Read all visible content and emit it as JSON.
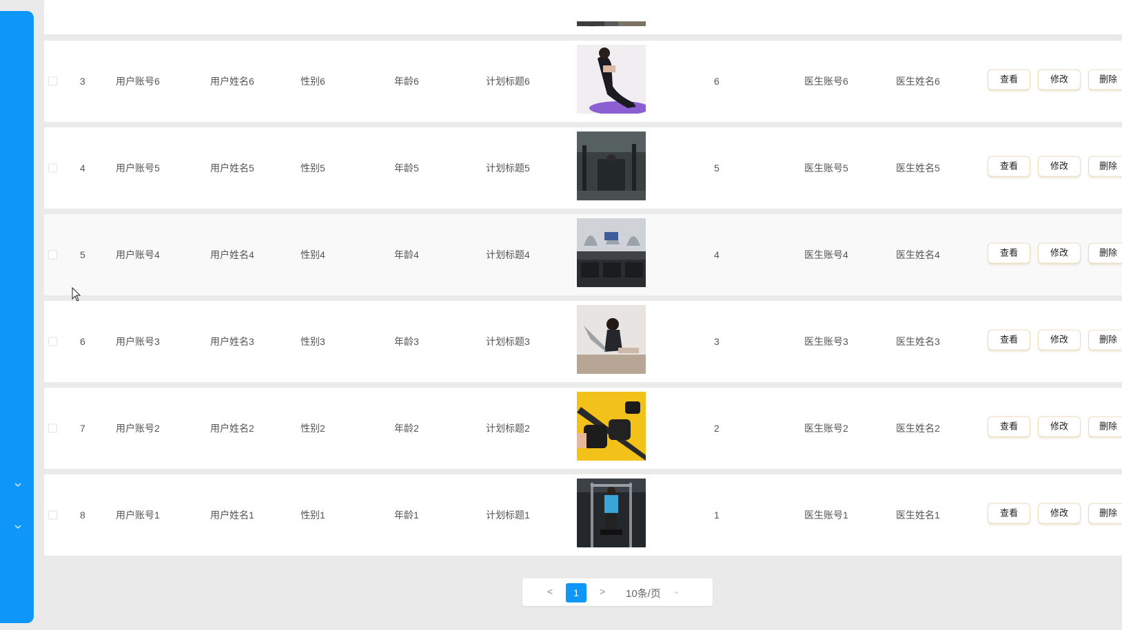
{
  "sidebar": {
    "icons": [
      "chevron-down-icon",
      "chevron-down-icon"
    ],
    "color": "#0e96f8"
  },
  "table": {
    "rows": [
      {
        "index": "3",
        "user_account": "用户账号6",
        "user_name": "用户姓名6",
        "gender": "性别6",
        "age": "年龄6",
        "plan_title": "计划标题6",
        "value": "6",
        "doctor_account": "医生账号6",
        "doctor_name": "医生姓名6",
        "image": "yoga-mat-photo"
      },
      {
        "index": "4",
        "user_account": "用户账号5",
        "user_name": "用户姓名5",
        "gender": "性别5",
        "age": "年龄5",
        "plan_title": "计划标题5",
        "value": "5",
        "doctor_account": "医生账号5",
        "doctor_name": "医生姓名5",
        "image": "gym-interior-photo"
      },
      {
        "index": "5",
        "user_account": "用户账号4",
        "user_name": "用户姓名4",
        "gender": "性别4",
        "age": "年龄4",
        "plan_title": "计划标题4",
        "value": "4",
        "doctor_account": "医生账号4",
        "doctor_name": "医生姓名4",
        "image": "treadmill-room-photo"
      },
      {
        "index": "6",
        "user_account": "用户账号3",
        "user_name": "用户姓名3",
        "gender": "性别3",
        "age": "年龄3",
        "plan_title": "计划标题3",
        "value": "3",
        "doctor_account": "医生账号3",
        "doctor_name": "医生姓名3",
        "image": "floor-stretch-photo"
      },
      {
        "index": "7",
        "user_account": "用户账号2",
        "user_name": "用户姓名2",
        "gender": "性别2",
        "age": "年龄2",
        "plan_title": "计划标题2",
        "value": "2",
        "doctor_account": "医生账号2",
        "doctor_name": "医生姓名2",
        "image": "wrist-weights-photo"
      },
      {
        "index": "8",
        "user_account": "用户账号1",
        "user_name": "用户姓名1",
        "gender": "性别1",
        "age": "年龄1",
        "plan_title": "计划标题1",
        "value": "1",
        "doctor_account": "医生账号1",
        "doctor_name": "医生姓名1",
        "image": "pullup-station-photo"
      }
    ],
    "actions": {
      "view": "查看",
      "edit": "修改",
      "delete": "删除"
    }
  },
  "pagination": {
    "prev": "<",
    "current_page": "1",
    "next": ">",
    "page_size": "10条/页"
  },
  "colors": {
    "accent": "#0e96f8",
    "button_border": "#eadcbc",
    "background": "#ebeaea"
  }
}
